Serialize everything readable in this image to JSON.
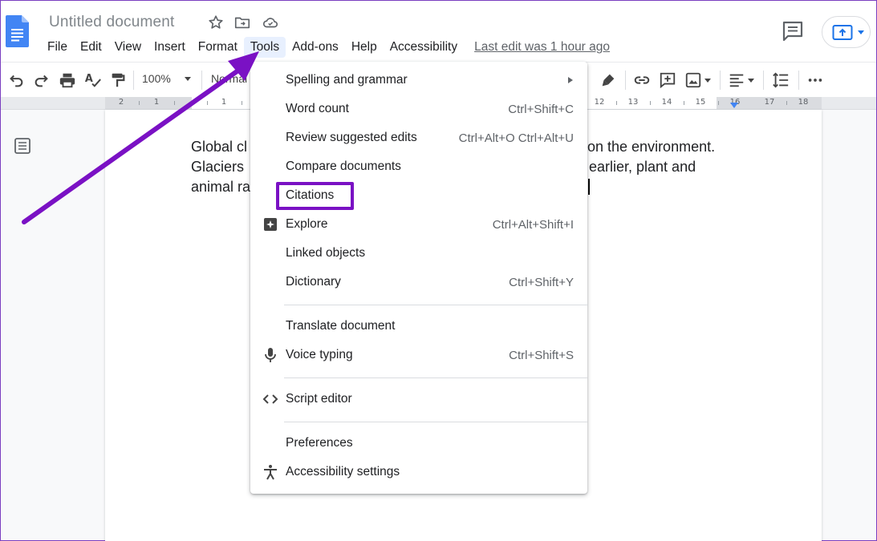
{
  "header": {
    "title": "Untitled document",
    "menus": [
      "File",
      "Edit",
      "View",
      "Insert",
      "Format",
      "Tools",
      "Add-ons",
      "Help",
      "Accessibility"
    ],
    "last_edit": "Last edit was 1 hour ago"
  },
  "toolbar": {
    "zoom": "100%",
    "style_partial": "Normal"
  },
  "ruler": {
    "numbers": [
      "2",
      "1",
      "1",
      "12",
      "13",
      "14",
      "15",
      "16",
      "17",
      "18"
    ]
  },
  "document": {
    "lines": [
      {
        "left": "Global cl",
        "right": "on the environment."
      },
      {
        "left": "Glaciers",
        "right": "earlier, plant and"
      },
      {
        "left": "animal ra",
        "right": ""
      }
    ]
  },
  "tools_menu": {
    "items": [
      {
        "label": "Spelling and grammar",
        "shortcut": "",
        "submenu": true,
        "icon": ""
      },
      {
        "label": "Word count",
        "shortcut": "Ctrl+Shift+C",
        "icon": ""
      },
      {
        "label": "Review suggested edits",
        "shortcut": "Ctrl+Alt+O Ctrl+Alt+U",
        "icon": ""
      },
      {
        "label": "Compare documents",
        "shortcut": "",
        "icon": ""
      },
      {
        "label": "Citations",
        "shortcut": "",
        "icon": "",
        "highlighted": true
      },
      {
        "label": "Explore",
        "shortcut": "Ctrl+Alt+Shift+I",
        "icon": "explore-icon"
      },
      {
        "label": "Linked objects",
        "shortcut": "",
        "icon": ""
      },
      {
        "label": "Dictionary",
        "shortcut": "Ctrl+Shift+Y",
        "icon": ""
      },
      {
        "label": "Translate document",
        "shortcut": "",
        "icon": ""
      },
      {
        "label": "Voice typing",
        "shortcut": "Ctrl+Shift+S",
        "icon": "microphone-icon"
      },
      {
        "label": "Script editor",
        "shortcut": "",
        "icon": "code-icon"
      },
      {
        "label": "Preferences",
        "shortcut": "",
        "icon": ""
      },
      {
        "label": "Accessibility settings",
        "shortcut": "",
        "icon": "accessibility-icon"
      }
    ]
  },
  "annotation": {
    "arrow_color": "#7a11c4",
    "highlight_color": "#7a11c4"
  }
}
